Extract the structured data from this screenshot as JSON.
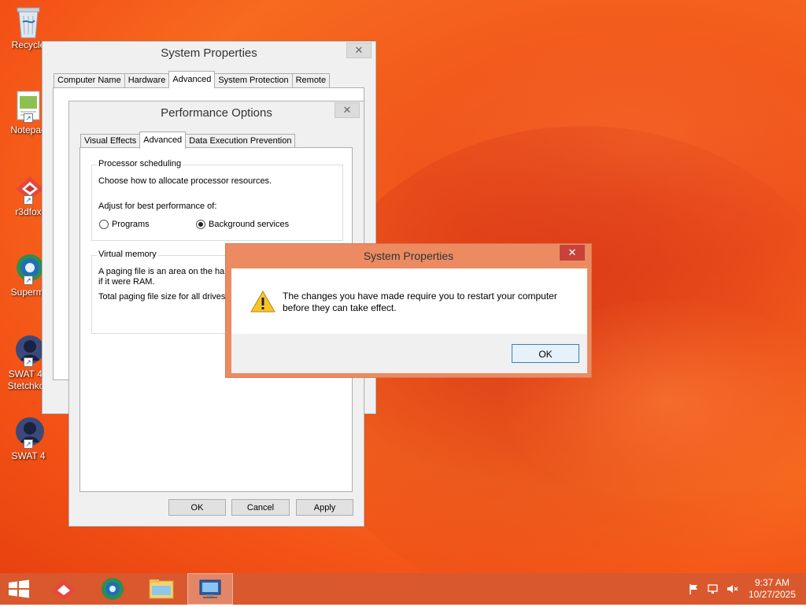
{
  "desktop": {
    "icons": [
      {
        "label": "Recycle",
        "icon": "recycle-bin-icon"
      },
      {
        "label": "Notepad",
        "icon": "notepad-icon"
      },
      {
        "label": "r3dfox",
        "icon": "r3dfox-icon"
      },
      {
        "label": "Supermi",
        "icon": "supermium-icon"
      },
      {
        "label": "SWAT 4 -",
        "label2": "Stetchkov",
        "icon": "swat4-icon"
      },
      {
        "label": "SWAT 4",
        "icon": "swat4-icon"
      }
    ]
  },
  "system_properties": {
    "title": "System Properties",
    "tabs": [
      "Computer Name",
      "Hardware",
      "Advanced",
      "System Protection",
      "Remote"
    ],
    "active_tab": "Advanced"
  },
  "performance_options": {
    "title": "Performance Options",
    "tabs": [
      "Visual Effects",
      "Advanced",
      "Data Execution Prevention"
    ],
    "active_tab": "Advanced",
    "processor_group": "Processor scheduling",
    "processor_desc": "Choose how to allocate processor resources.",
    "adjust_label": "Adjust for best performance of:",
    "radio_programs": "Programs",
    "radio_background": "Background services",
    "selected_option": "Background services",
    "virtual_group": "Virtual memory",
    "vm_line1": "A paging file is an area on the har",
    "vm_line2": "if it were RAM.",
    "vm_line3": "Total paging file size for all drives",
    "buttons": {
      "ok": "OK",
      "cancel": "Cancel",
      "apply": "Apply"
    }
  },
  "alert": {
    "title": "System Properties",
    "message_line1": "The changes you have made require you to restart your computer",
    "message_line2": "before they can take effect.",
    "ok": "OK"
  },
  "taskbar": {
    "time": "9:37 AM",
    "date": "10/27/2025"
  },
  "colors": {
    "accent_window_frame": "#ec8b62",
    "taskbar": "#d9582e",
    "close_red": "#c7433a"
  }
}
